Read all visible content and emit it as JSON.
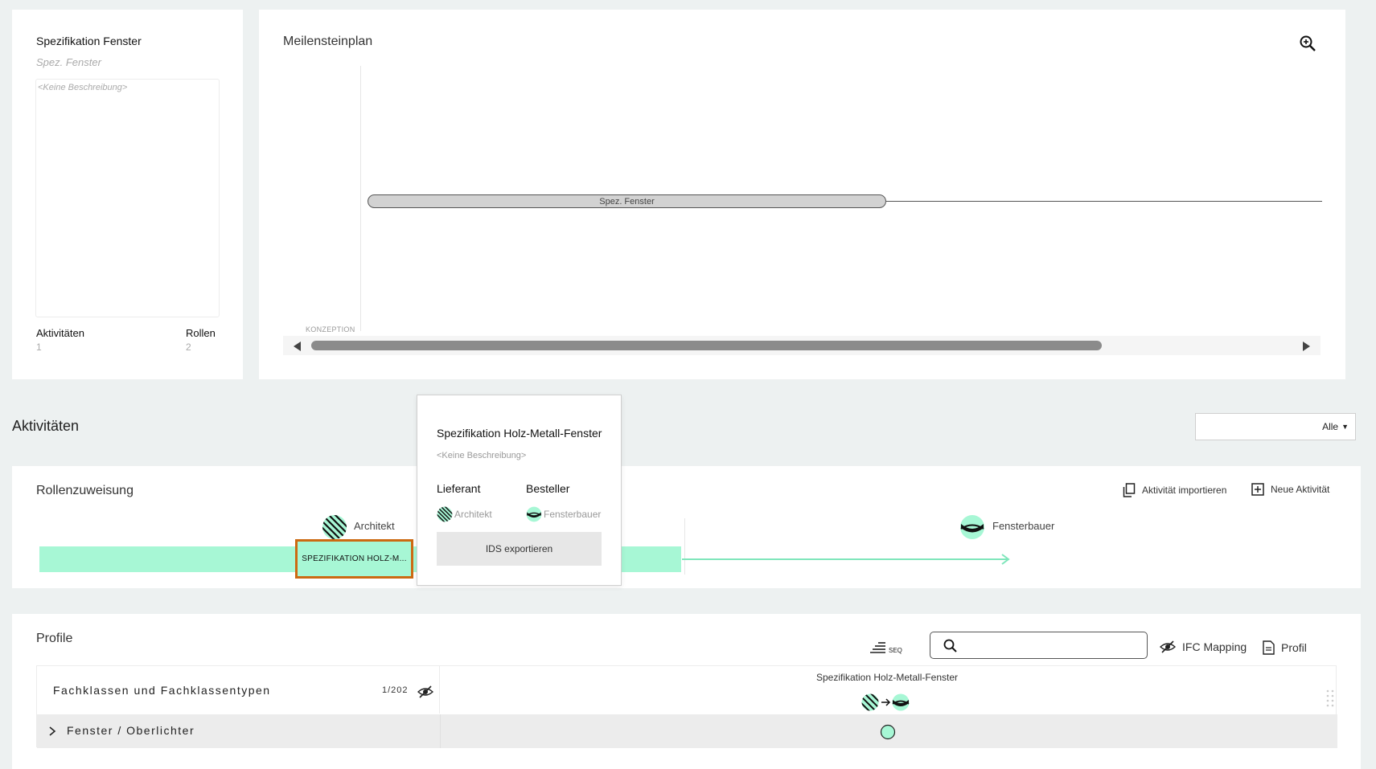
{
  "colors": {
    "accent": "#a7f7d5",
    "highlight": "#cc6a12",
    "background": "#edf1f1"
  },
  "project": {
    "title": "Spezifikation Fenster",
    "short": "Spez. Fenster",
    "description": "<Keine Beschreibung>",
    "stats": [
      {
        "label": "Aktivitäten",
        "value": "1"
      },
      {
        "label": "Rollen",
        "value": "2"
      }
    ]
  },
  "milestones": {
    "title": "Meilensteinplan",
    "zoom_icon": "zoom-in-icon",
    "bar_label": "Spez. Fenster",
    "phase_label": "KONZEPTION"
  },
  "activities": {
    "heading": "Aktivitäten",
    "filter_value": "Alle"
  },
  "roles": {
    "title": "Rollenzuweisung",
    "import_label": "Aktivität importieren",
    "new_label": "Neue Aktivität",
    "role_a": "Architekt",
    "role_b": "Fensterbauer",
    "activity_chip": "SPEZIFIKATION HOLZ-M..."
  },
  "popover": {
    "title": "Spezifikation Holz-Metall-Fenster",
    "description": "<Keine Beschreibung>",
    "supplier_heading": "Lieferant",
    "orderer_heading": "Besteller",
    "supplier_role": "Architekt",
    "orderer_role": "Fensterbauer",
    "export_label": "IDS exportieren"
  },
  "profiles": {
    "title": "Profile",
    "seq_label": "SEQ",
    "search_placeholder": "",
    "ifc_label": "IFC Mapping",
    "profile_label": "Profil",
    "group_label": "Fachklassen und Fachklassentypen",
    "group_count": "1/202",
    "column_title": "Spezifikation Holz-Metall-Fenster",
    "row_label": "Fenster / Oberlichter"
  }
}
